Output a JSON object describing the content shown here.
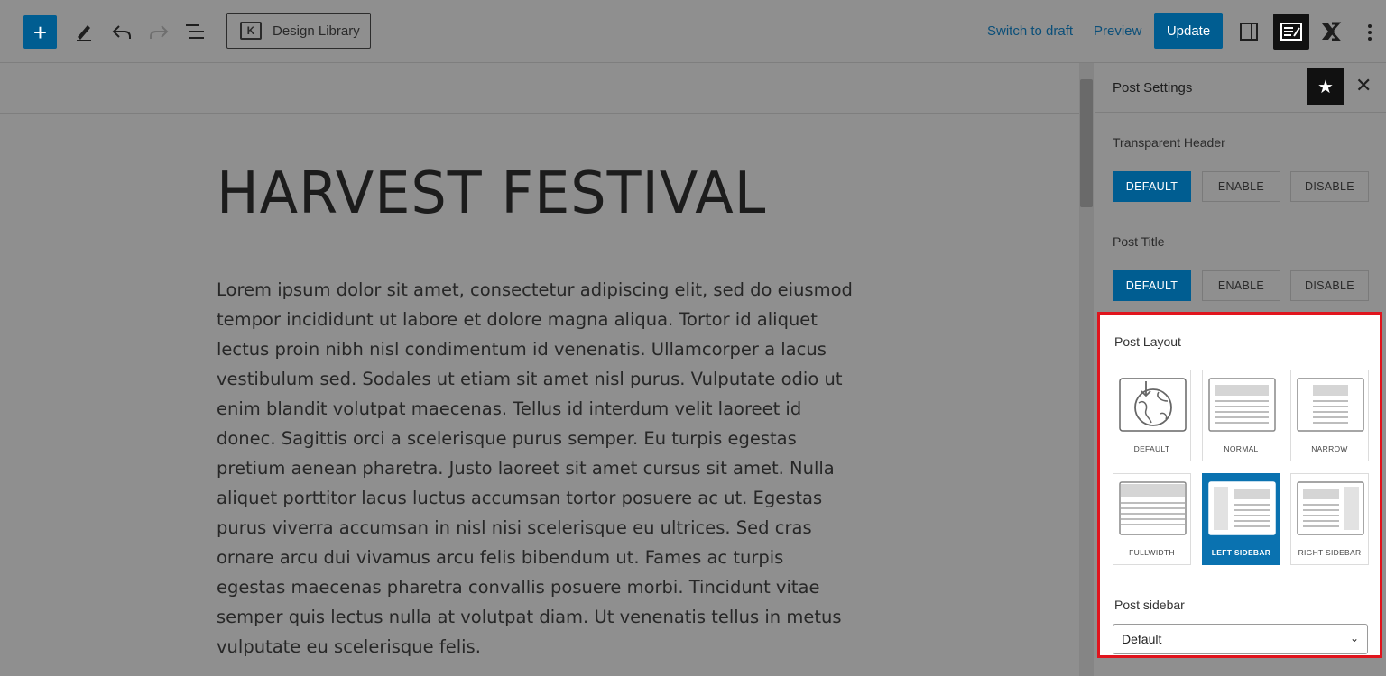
{
  "toolbar": {
    "add_icon": "plus-icon",
    "tools": [
      "pencil-icon",
      "undo-icon",
      "redo-icon",
      "list-view-icon"
    ],
    "design_library_label": "Design Library",
    "switch_to_draft": "Switch to draft",
    "preview": "Preview",
    "update": "Update",
    "right_icons": [
      "sidebar-toggle-icon",
      "post-settings-icon",
      "kadence-icon",
      "more-options-icon"
    ]
  },
  "post": {
    "title": "HARVEST FESTIVAL",
    "body": "Lorem ipsum dolor sit amet, consectetur adipiscing elit, sed do eiusmod tempor incididunt ut labore et dolore magna aliqua. Tortor id aliquet lectus proin nibh nisl condimentum id venenatis. Ullamcorper a lacus vestibulum sed. Sodales ut etiam sit amet nisl purus. Vulputate odio ut enim blandit volutpat maecenas. Tellus id interdum velit laoreet id donec. Sagittis orci a scelerisque purus semper. Eu turpis egestas pretium aenean pharetra. Justo laoreet sit amet cursus sit amet. Nulla aliquet porttitor lacus luctus accumsan tortor posuere ac ut. Egestas purus viverra accumsan in nisl nisi scelerisque eu ultrices. Sed cras ornare arcu dui vivamus arcu felis bibendum ut. Fames ac turpis egestas maecenas pharetra convallis posuere morbi. Tincidunt vitae semper quis lectus nulla at volutpat diam. Ut venenatis tellus in metus vulputate eu scelerisque felis."
  },
  "sidebar": {
    "title": "Post Settings",
    "transparent_header": {
      "label": "Transparent Header",
      "options": [
        "DEFAULT",
        "ENABLE",
        "DISABLE"
      ],
      "selected": "DEFAULT"
    },
    "post_title": {
      "label": "Post Title",
      "options": [
        "DEFAULT",
        "ENABLE",
        "DISABLE"
      ],
      "selected": "DEFAULT"
    },
    "post_layout": {
      "label": "Post Layout",
      "options": [
        "DEFAULT",
        "NORMAL",
        "NARROW",
        "FULLWIDTH",
        "LEFT SIDEBAR",
        "RIGHT SIDEBAR"
      ],
      "selected": "LEFT SIDEBAR"
    },
    "post_sidebar": {
      "label": "Post sidebar",
      "value": "Default"
    }
  },
  "colors": {
    "accent": "#005d91",
    "selected_tile": "#0a72b0",
    "highlight_border": "#e0141d",
    "overlay_gray": "#8f8f8f"
  }
}
